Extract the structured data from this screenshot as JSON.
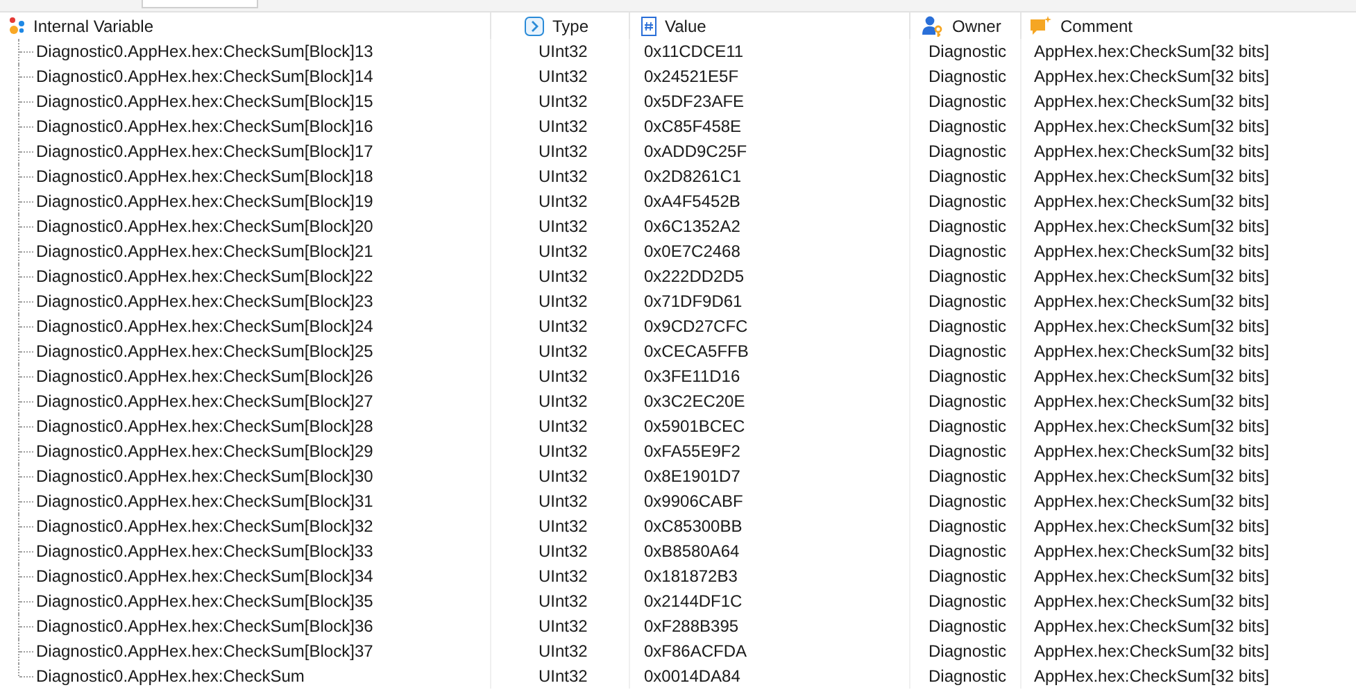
{
  "columns": [
    {
      "kind": "name",
      "label": "Internal Variable"
    },
    {
      "kind": "type",
      "label": "Type"
    },
    {
      "kind": "value",
      "label": "Value"
    },
    {
      "kind": "owner",
      "label": "Owner"
    },
    {
      "kind": "comment",
      "label": "Comment"
    }
  ],
  "rows": [
    {
      "name": "Diagnostic0.AppHex.hex:CheckSum[Block]13",
      "type": "UInt32",
      "value": "0x11CDCE11",
      "owner": "Diagnostic",
      "comment": "AppHex.hex:CheckSum[32 bits]"
    },
    {
      "name": "Diagnostic0.AppHex.hex:CheckSum[Block]14",
      "type": "UInt32",
      "value": "0x24521E5F",
      "owner": "Diagnostic",
      "comment": "AppHex.hex:CheckSum[32 bits]"
    },
    {
      "name": "Diagnostic0.AppHex.hex:CheckSum[Block]15",
      "type": "UInt32",
      "value": "0x5DF23AFE",
      "owner": "Diagnostic",
      "comment": "AppHex.hex:CheckSum[32 bits]"
    },
    {
      "name": "Diagnostic0.AppHex.hex:CheckSum[Block]16",
      "type": "UInt32",
      "value": "0xC85F458E",
      "owner": "Diagnostic",
      "comment": "AppHex.hex:CheckSum[32 bits]"
    },
    {
      "name": "Diagnostic0.AppHex.hex:CheckSum[Block]17",
      "type": "UInt32",
      "value": "0xADD9C25F",
      "owner": "Diagnostic",
      "comment": "AppHex.hex:CheckSum[32 bits]"
    },
    {
      "name": "Diagnostic0.AppHex.hex:CheckSum[Block]18",
      "type": "UInt32",
      "value": "0x2D8261C1",
      "owner": "Diagnostic",
      "comment": "AppHex.hex:CheckSum[32 bits]"
    },
    {
      "name": "Diagnostic0.AppHex.hex:CheckSum[Block]19",
      "type": "UInt32",
      "value": "0xA4F5452B",
      "owner": "Diagnostic",
      "comment": "AppHex.hex:CheckSum[32 bits]"
    },
    {
      "name": "Diagnostic0.AppHex.hex:CheckSum[Block]20",
      "type": "UInt32",
      "value": "0x6C1352A2",
      "owner": "Diagnostic",
      "comment": "AppHex.hex:CheckSum[32 bits]"
    },
    {
      "name": "Diagnostic0.AppHex.hex:CheckSum[Block]21",
      "type": "UInt32",
      "value": "0x0E7C2468",
      "owner": "Diagnostic",
      "comment": "AppHex.hex:CheckSum[32 bits]"
    },
    {
      "name": "Diagnostic0.AppHex.hex:CheckSum[Block]22",
      "type": "UInt32",
      "value": "0x222DD2D5",
      "owner": "Diagnostic",
      "comment": "AppHex.hex:CheckSum[32 bits]"
    },
    {
      "name": "Diagnostic0.AppHex.hex:CheckSum[Block]23",
      "type": "UInt32",
      "value": "0x71DF9D61",
      "owner": "Diagnostic",
      "comment": "AppHex.hex:CheckSum[32 bits]"
    },
    {
      "name": "Diagnostic0.AppHex.hex:CheckSum[Block]24",
      "type": "UInt32",
      "value": "0x9CD27CFC",
      "owner": "Diagnostic",
      "comment": "AppHex.hex:CheckSum[32 bits]"
    },
    {
      "name": "Diagnostic0.AppHex.hex:CheckSum[Block]25",
      "type": "UInt32",
      "value": "0xCECA5FFB",
      "owner": "Diagnostic",
      "comment": "AppHex.hex:CheckSum[32 bits]"
    },
    {
      "name": "Diagnostic0.AppHex.hex:CheckSum[Block]26",
      "type": "UInt32",
      "value": "0x3FE11D16",
      "owner": "Diagnostic",
      "comment": "AppHex.hex:CheckSum[32 bits]"
    },
    {
      "name": "Diagnostic0.AppHex.hex:CheckSum[Block]27",
      "type": "UInt32",
      "value": "0x3C2EC20E",
      "owner": "Diagnostic",
      "comment": "AppHex.hex:CheckSum[32 bits]"
    },
    {
      "name": "Diagnostic0.AppHex.hex:CheckSum[Block]28",
      "type": "UInt32",
      "value": "0x5901BCEC",
      "owner": "Diagnostic",
      "comment": "AppHex.hex:CheckSum[32 bits]"
    },
    {
      "name": "Diagnostic0.AppHex.hex:CheckSum[Block]29",
      "type": "UInt32",
      "value": "0xFA55E9F2",
      "owner": "Diagnostic",
      "comment": "AppHex.hex:CheckSum[32 bits]"
    },
    {
      "name": "Diagnostic0.AppHex.hex:CheckSum[Block]30",
      "type": "UInt32",
      "value": "0x8E1901D7",
      "owner": "Diagnostic",
      "comment": "AppHex.hex:CheckSum[32 bits]"
    },
    {
      "name": "Diagnostic0.AppHex.hex:CheckSum[Block]31",
      "type": "UInt32",
      "value": "0x9906CABF",
      "owner": "Diagnostic",
      "comment": "AppHex.hex:CheckSum[32 bits]"
    },
    {
      "name": "Diagnostic0.AppHex.hex:CheckSum[Block]32",
      "type": "UInt32",
      "value": "0xC85300BB",
      "owner": "Diagnostic",
      "comment": "AppHex.hex:CheckSum[32 bits]"
    },
    {
      "name": "Diagnostic0.AppHex.hex:CheckSum[Block]33",
      "type": "UInt32",
      "value": "0xB8580A64",
      "owner": "Diagnostic",
      "comment": "AppHex.hex:CheckSum[32 bits]"
    },
    {
      "name": "Diagnostic0.AppHex.hex:CheckSum[Block]34",
      "type": "UInt32",
      "value": "0x181872B3",
      "owner": "Diagnostic",
      "comment": "AppHex.hex:CheckSum[32 bits]"
    },
    {
      "name": "Diagnostic0.AppHex.hex:CheckSum[Block]35",
      "type": "UInt32",
      "value": "0x2144DF1C",
      "owner": "Diagnostic",
      "comment": "AppHex.hex:CheckSum[32 bits]"
    },
    {
      "name": "Diagnostic0.AppHex.hex:CheckSum[Block]36",
      "type": "UInt32",
      "value": "0xF288B395",
      "owner": "Diagnostic",
      "comment": "AppHex.hex:CheckSum[32 bits]"
    },
    {
      "name": "Diagnostic0.AppHex.hex:CheckSum[Block]37",
      "type": "UInt32",
      "value": "0xF86ACFDA",
      "owner": "Diagnostic",
      "comment": "AppHex.hex:CheckSum[32 bits]"
    },
    {
      "name": "Diagnostic0.AppHex.hex:CheckSum",
      "type": "UInt32",
      "value": "0x0014DA84",
      "owner": "Diagnostic",
      "comment": "AppHex.hex:CheckSum[32 bits]"
    }
  ]
}
